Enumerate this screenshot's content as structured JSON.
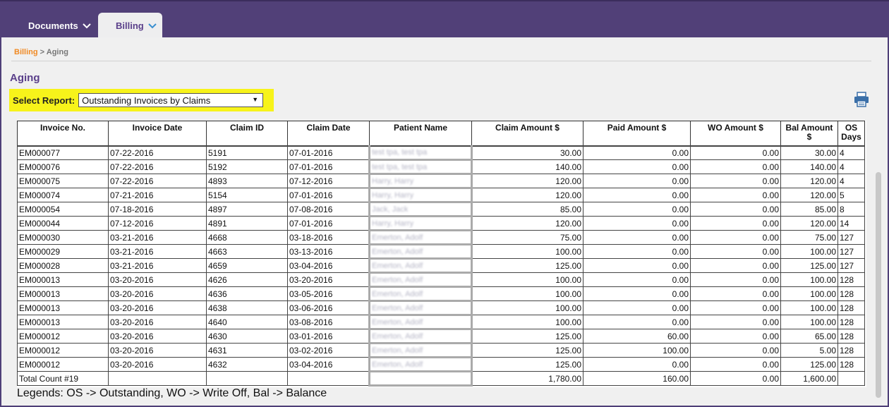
{
  "nav": {
    "documents": "Documents",
    "billing": "Billing"
  },
  "breadcrumb": {
    "parent": "Billing",
    "separator": ">",
    "current": "Aging"
  },
  "page_title": "Aging",
  "report": {
    "label": "Select Report:",
    "selected": "Outstanding Invoices by Claims"
  },
  "table": {
    "headers": [
      "Invoice No.",
      "Invoice Date",
      "Claim ID",
      "Claim Date",
      "Patient Name",
      "Claim Amount $",
      "Paid Amount $",
      "WO Amount $",
      "Bal Amount $",
      "OS Days"
    ],
    "rows": [
      [
        "EM000077",
        "07-22-2016",
        "5191",
        "07-01-2016",
        "test tpa, test tpa",
        "30.00",
        "0.00",
        "0.00",
        "30.00",
        "4"
      ],
      [
        "EM000076",
        "07-22-2016",
        "5192",
        "07-01-2016",
        "test tpa, test tpa",
        "140.00",
        "0.00",
        "0.00",
        "140.00",
        "4"
      ],
      [
        "EM000075",
        "07-22-2016",
        "4893",
        "07-12-2016",
        "Harry, Harry",
        "120.00",
        "0.00",
        "0.00",
        "120.00",
        "4"
      ],
      [
        "EM000074",
        "07-21-2016",
        "5154",
        "07-01-2016",
        "Harry, Harry",
        "120.00",
        "0.00",
        "0.00",
        "120.00",
        "5"
      ],
      [
        "EM000054",
        "07-18-2016",
        "4897",
        "07-08-2016",
        "Jack, Jack",
        "85.00",
        "0.00",
        "0.00",
        "85.00",
        "8"
      ],
      [
        "EM000044",
        "07-12-2016",
        "4891",
        "07-01-2016",
        "Harry, Harry",
        "120.00",
        "0.00",
        "0.00",
        "120.00",
        "14"
      ],
      [
        "EM000030",
        "03-21-2016",
        "4668",
        "03-18-2016",
        "Emerton, Adolf",
        "75.00",
        "0.00",
        "0.00",
        "75.00",
        "127"
      ],
      [
        "EM000029",
        "03-21-2016",
        "4663",
        "03-13-2016",
        "Emerton, Adolf",
        "100.00",
        "0.00",
        "0.00",
        "100.00",
        "127"
      ],
      [
        "EM000028",
        "03-21-2016",
        "4659",
        "03-04-2016",
        "Emerton, Adolf",
        "125.00",
        "0.00",
        "0.00",
        "125.00",
        "127"
      ],
      [
        "EM000013",
        "03-20-2016",
        "4626",
        "03-20-2016",
        "Emerton, Adolf",
        "100.00",
        "0.00",
        "0.00",
        "100.00",
        "128"
      ],
      [
        "EM000013",
        "03-20-2016",
        "4636",
        "03-05-2016",
        "Emerton, Adolf",
        "100.00",
        "0.00",
        "0.00",
        "100.00",
        "128"
      ],
      [
        "EM000013",
        "03-20-2016",
        "4638",
        "03-06-2016",
        "Emerton, Adolf",
        "100.00",
        "0.00",
        "0.00",
        "100.00",
        "128"
      ],
      [
        "EM000013",
        "03-20-2016",
        "4640",
        "03-08-2016",
        "Emerton, Adolf",
        "100.00",
        "0.00",
        "0.00",
        "100.00",
        "128"
      ],
      [
        "EM000012",
        "03-20-2016",
        "4630",
        "03-01-2016",
        "Emerton, Adolf",
        "125.00",
        "60.00",
        "0.00",
        "65.00",
        "128"
      ],
      [
        "EM000012",
        "03-20-2016",
        "4631",
        "03-02-2016",
        "Emerton, Adolf",
        "125.00",
        "100.00",
        "0.00",
        "5.00",
        "128"
      ],
      [
        "EM000012",
        "03-20-2016",
        "4632",
        "03-04-2016",
        "Emerton, Adolf",
        "125.00",
        "0.00",
        "0.00",
        "125.00",
        "128"
      ]
    ],
    "total": [
      "Total Count #19",
      "",
      "",
      "",
      "",
      "1,780.00",
      "160.00",
      "0.00",
      "1,600.00",
      ""
    ]
  },
  "legend": "Legends: OS -> Outstanding, WO -> Write Off, Bal -> Balance",
  "colors": {
    "topbar": "#514078",
    "accent_purple": "#5a3f8a",
    "breadcrumb_link": "#f08a24",
    "highlight": "#f7f31a"
  },
  "icons": [
    "chevron-down-icon",
    "printer-icon"
  ]
}
